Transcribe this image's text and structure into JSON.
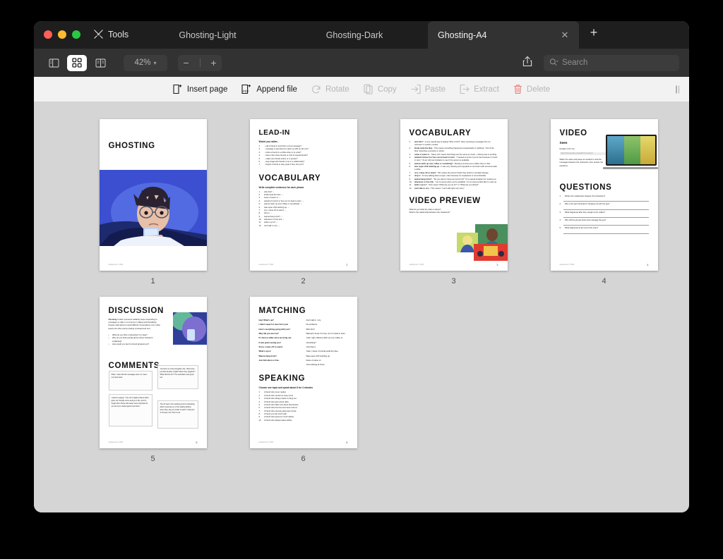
{
  "window": {
    "traffic_lights": [
      "close",
      "minimize",
      "zoom"
    ],
    "tools_label": "Tools",
    "tabs": [
      {
        "title": "Ghosting-Light",
        "active": false,
        "closable": false
      },
      {
        "title": "Ghosting-Dark",
        "active": false,
        "closable": false
      },
      {
        "title": "Ghosting-A4",
        "active": true,
        "closable": true
      }
    ],
    "new_tab_label": "+"
  },
  "toolbar": {
    "sidebar_toggle": "sidebar-icon",
    "thumbnail_view": "grid-icon",
    "split_view": "split-icon",
    "zoom_level": "42%",
    "zoom_chevron": "⌄",
    "zoom_out": "−",
    "zoom_in": "+",
    "share": "share-icon",
    "search_placeholder": "Search",
    "search_value": ""
  },
  "actions": [
    {
      "label": "Insert page",
      "icon": "insert-page-icon",
      "enabled": true
    },
    {
      "label": "Append file",
      "icon": "append-file-icon",
      "enabled": true
    },
    {
      "label": "Rotate",
      "icon": "rotate-icon",
      "enabled": false
    },
    {
      "label": "Copy",
      "icon": "copy-icon",
      "enabled": false
    },
    {
      "label": "Paste",
      "icon": "paste-icon",
      "enabled": false
    },
    {
      "label": "Extract",
      "icon": "extract-icon",
      "enabled": false
    },
    {
      "label": "Delete",
      "icon": "trash-icon",
      "enabled": false
    }
  ],
  "colors": {
    "titlebar": "#1e1e1e",
    "toolbar": "#323232",
    "actionbar": "#f2f2f2",
    "canvas": "#d5d5d5",
    "accent_red": "#ff5f57",
    "accent_yellow": "#febc2e",
    "accent_green": "#28c840",
    "delete_red": "#e8857f"
  },
  "document": {
    "page_count": 6,
    "pages": [
      {
        "number": "1",
        "kind": "cover",
        "title": "GHOSTING",
        "footer_left": "edutainment © 2024",
        "image_alt": "boy in bed at night looking at phone"
      },
      {
        "number": "2",
        "kind": "lead-in",
        "footer_left": "edutainment © 2024",
        "sections": [
          {
            "heading": "LEAD-IN",
            "instruction": "Would you rather...",
            "items": [
              "...call a friend or send them a text message?",
              "...message a new friend or catch up with an old one?",
              "...invite a friend to a coffee shop or to a bar?",
              "...have a few close friends or a lot of casual friends?",
              "...make new friends online or in person?",
              "...stay single with friends or be in a relationship?",
              "...forgive a friend or stay upset if they hurt you?"
            ]
          },
          {
            "heading": "VOCABULARY",
            "instruction": "Write complete sentences for each phrase",
            "items": [
              "who this? →",
              "kinda outta the blue →",
              "same ol same ol →",
              "wanted 2 know if ur free cuz im back in town →",
              "wanna catch up over coffee or something? →",
              "was super chill catching up →",
              "srry i came off so weird →",
              "drop it →",
              "wanna hang tmrw? →",
              "whenever ur free lmk →",
              "what u up to? →",
              "can't talk rn srry →"
            ]
          }
        ]
      },
      {
        "number": "3",
        "kind": "vocabulary",
        "footer_left": "edutainment © 2024",
        "sections": [
          {
            "heading": "VOCABULARY",
            "items": [
              {
                "term": "who this?",
                "definition": "A very casual way of asking \"Who is this?\" when receiving a message from an unknown or random contact."
              },
              {
                "term": "kinda outta the blue",
                "definition": "This means something happened unexpectedly or suddenly. \"Out of the blue\" describes a surprise or shock."
              },
              {
                "term": "same ol same ol",
                "definition": "\"Same old\" means that things are the same as usual – nothing new or exciting."
              },
              {
                "term": "wanted 2 know if ur free cuz im back in town",
                "definition": "\"I wanted to know if you're free because I'm back in town.\" It's an informal invitation to see if the person is available."
              },
              {
                "term": "wanna catch up over coffee or something?",
                "definition": "Meeting someone at a coffee shop to chat."
              },
              {
                "term": "was super chill catching up",
                "definition": "It was very relaxing and enjoyable to reconnect with someone after a while."
              },
              {
                "term": "srry i came off so weird",
                "definition": "This means the person thinks they acted or sounded strange."
              },
              {
                "term": "drop it",
                "definition": "To stop talking about a topic, often because it's unpleasant or uncomfortable."
              },
              {
                "term": "wanna hang tmrw?",
                "definition": "\"Do you want to hang out tomorrow?\" It's a casual invitation for meeting up."
              },
              {
                "term": "whenever ur free lmk",
                "definition": "\"Let me know when you're available.\" It's an open-ended offer to meet up."
              },
              {
                "term": "what u up to?",
                "definition": "This means \"What are you up to?\" or \"What are you doing?\""
              },
              {
                "term": "can't talk rn srry",
                "definition": "This means \"I can't talk right now, sorry.\""
              }
            ]
          },
          {
            "heading": "VIDEO PREVIEW",
            "items": [
              "What do you think the video is about?",
              "What is the relationship between the characters?"
            ]
          }
        ]
      },
      {
        "number": "4",
        "kind": "video",
        "footer_left": "edutainment © 2024",
        "sections": [
          {
            "heading": "VIDEO",
            "video_title": "Seen",
            "duration": "Duration 3:47 min",
            "link_placeholder": "https://www.youtube.com/watch?v=xxxxxxxx",
            "instruction": "Watch the video and pause as needed to read the messages between the characters, then answer the questions."
          },
          {
            "heading": "QUESTIONS",
            "items": [
              "What's the relationship between the characters?",
              "Why is the girl interested in hanging out with the guy?",
              "What happened after they caught up for coffee?",
              "Why did the girl get drunk and message the guy?",
              "What happened at the end of the story?"
            ]
          }
        ]
      },
      {
        "number": "5",
        "kind": "discussion",
        "footer_left": "edutainment © 2024",
        "sections": [
          {
            "heading": "DISCUSSION",
            "definition_term": "Ghosting",
            "definition_text": "is when someone suddenly stops responding to messages or calls. It is common in dating and friendships. People might ghost to avoid difficult conversations, but it often leaves the other person feeling confused and hurt.",
            "items": [
              "What do you think of ghosting? Is it okay?",
              "Why do you think people ghost others instead of explaining?",
              "How would you feel if a friend ghosted you?"
            ]
          },
          {
            "heading": "COMMENTS",
            "comments": [
              "When I saw that the messages were on 'seen,' my heart sank.",
              "You have so many thoughts, like, 'Were they just friends after a fight? Were they together? What did she do?' The animation was great too.",
              "I heard a saying: \"You can't relight a flame that's gone out. People come and go in life, and it's tough when those who leave were important to you and you shared good memories.\"",
              "The bit real: From deleting texts to panicking about messing up, to the waiting feeling when they say you made it weird. It was just 4 minutes, but I felt it a lot."
            ]
          }
        ]
      },
      {
        "number": "6",
        "kind": "matching",
        "footer_left": "edutainment © 2024",
        "sections": [
          {
            "heading": "MATCHING",
            "left_column": [
              "Hey! What's up?",
              "I didn't expect to hear from you!",
              "How's everything going with you?",
              "Why did you text me?",
              "It's been a while since we hung out.",
              "It was great seeing you!",
              "Sorry, I came off so weird.",
              "What's up lol",
              "Wanna hang tmrw?",
              "Just link when ur free."
            ],
            "right_column": [
              "Can't talk rn, srry.",
              "No problems.",
              "Who this?",
              "Wanted 2 know if ur free cuz I'm back in town.",
              "Yeah, right. Wanna catch up over coffee or something?",
              "Just drop it.",
              "Yeah, I know, it's kinda outta the blue.",
              "Was super chill catching up.",
              "Same ol same ol.",
              "Just relaxing at home."
            ]
          },
          {
            "heading": "SPEAKING",
            "instruction": "Choose one topic and speak about it for 3 minutes",
            "items": [
              "A friend who never replies",
              "A friend who sends too many texts",
              "A friend who always wants to hang out",
              "A friend who gets drunk often",
              "A friend who talks only about themselves",
              "A friend who borrows and never returns",
              "A friend who cancels plans last minute",
              "A friend you lost touch with",
              "A friend who gives too much advice",
              "A friend who always takes selfies"
            ]
          }
        ]
      }
    ]
  }
}
